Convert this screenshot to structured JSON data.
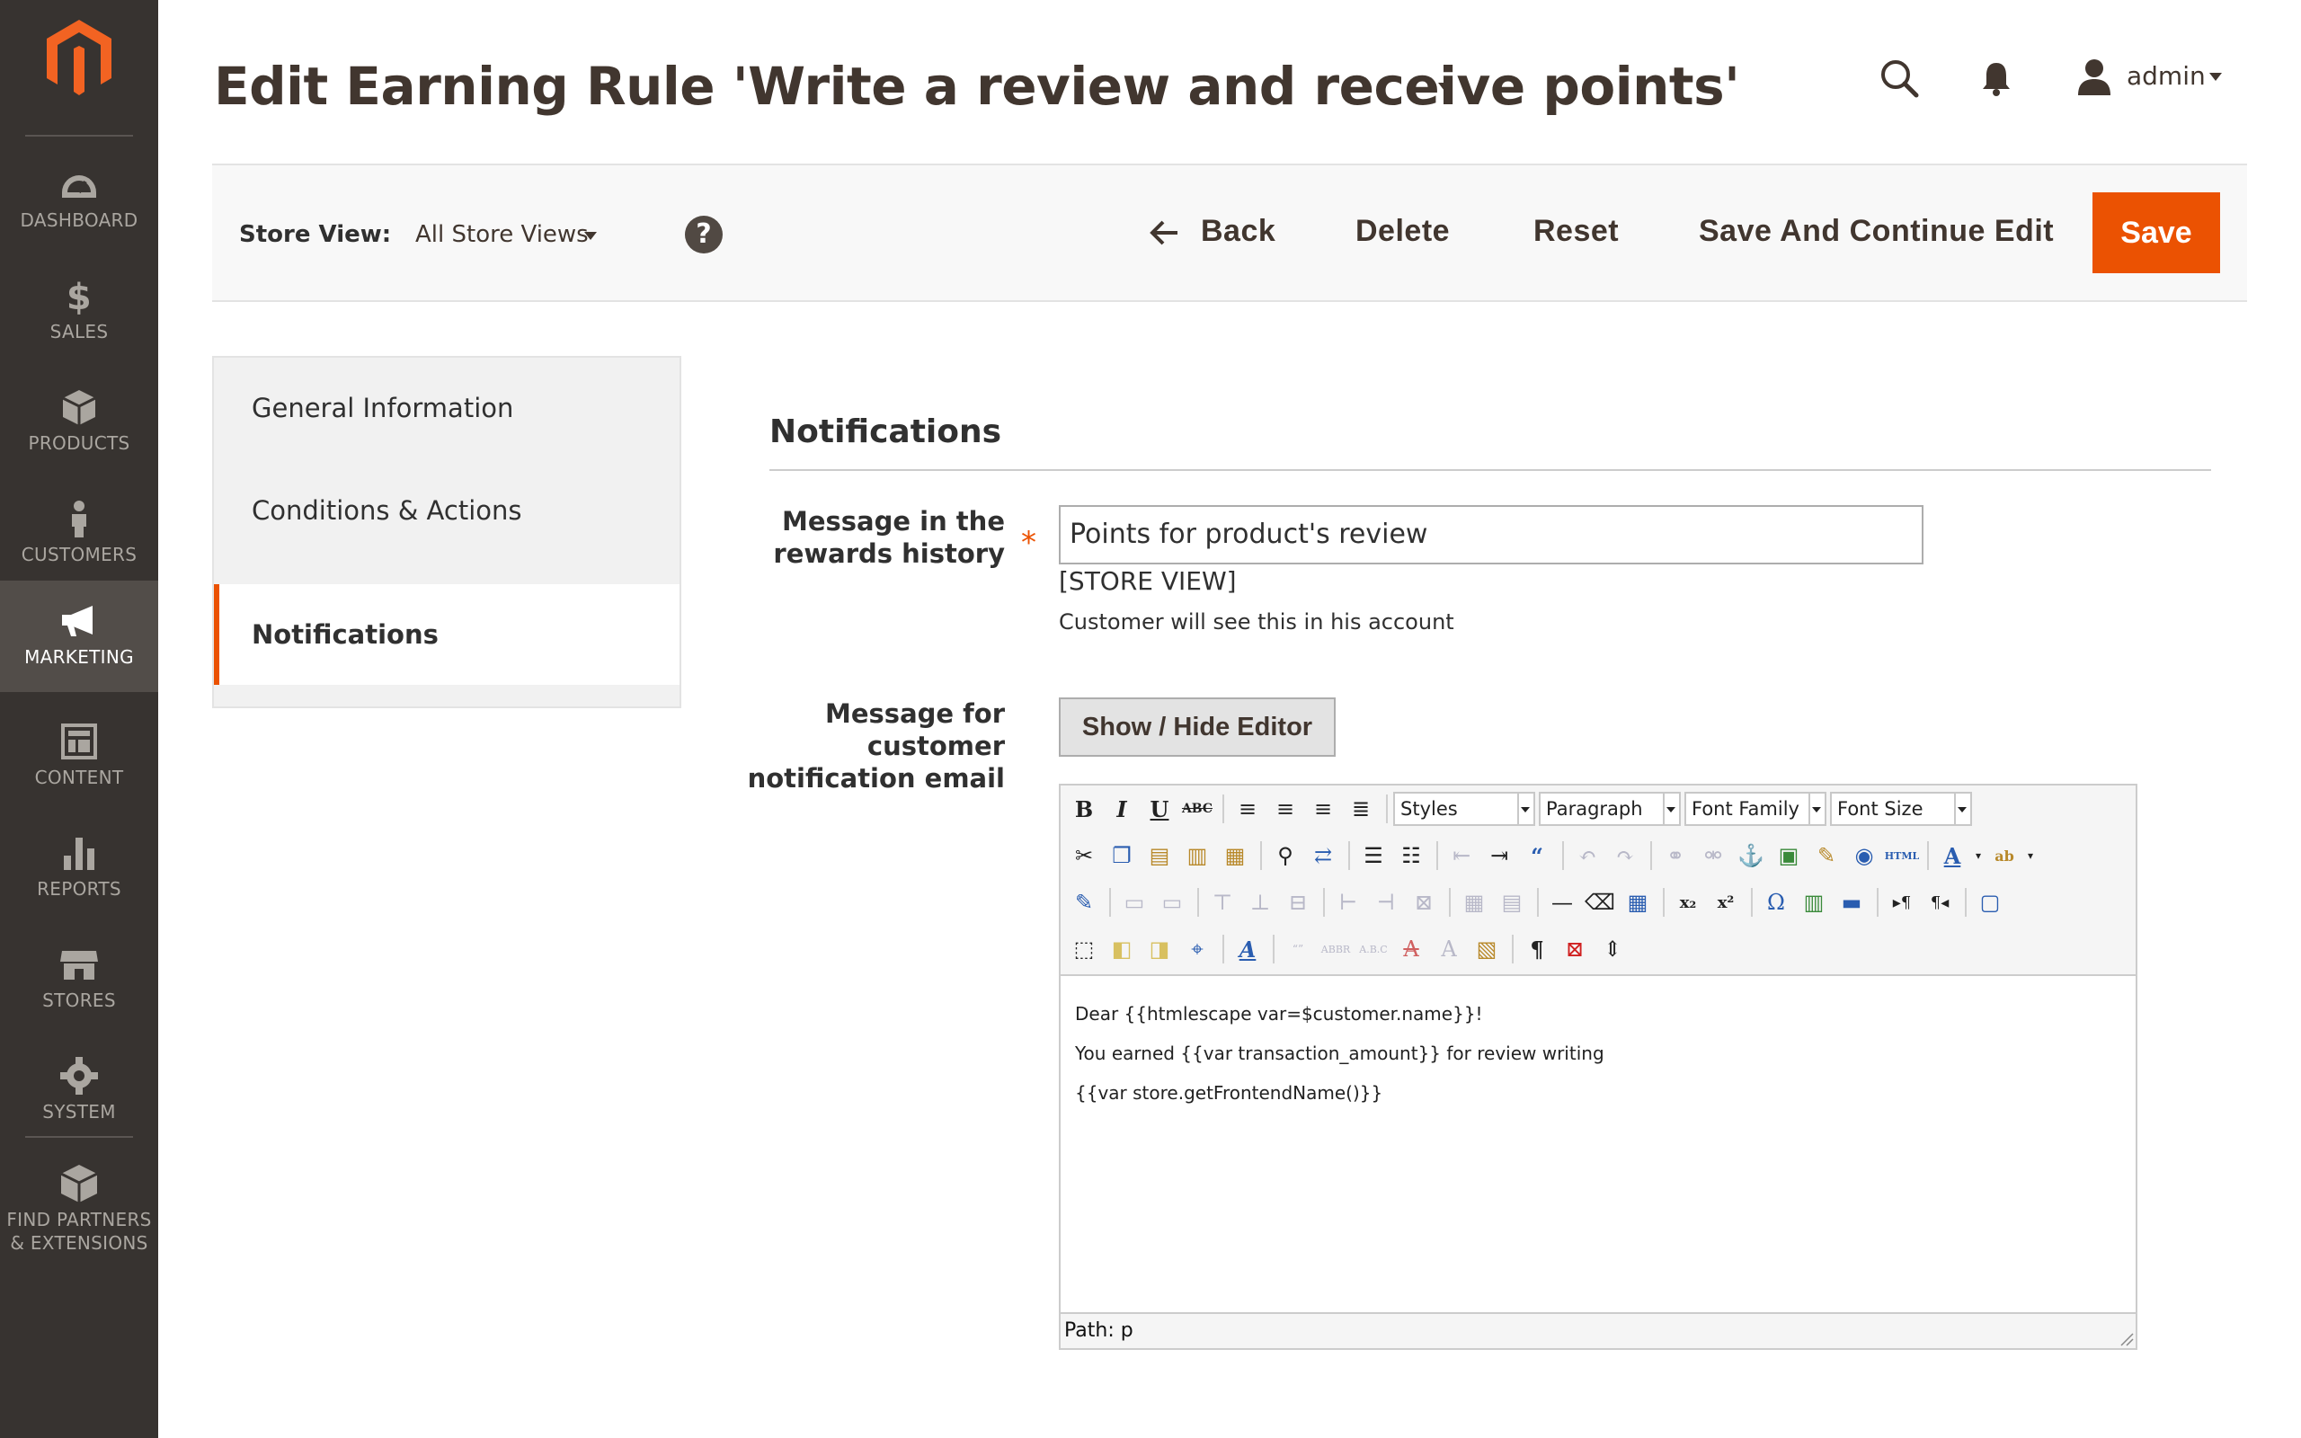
{
  "sidebar": {
    "items": [
      {
        "label": "DASHBOARD",
        "icon": "dashboard-icon"
      },
      {
        "label": "SALES",
        "icon": "dollar-icon"
      },
      {
        "label": "PRODUCTS",
        "icon": "box-icon"
      },
      {
        "label": "CUSTOMERS",
        "icon": "person-icon"
      },
      {
        "label": "MARKETING",
        "icon": "megaphone-icon",
        "active": true
      },
      {
        "label": "CONTENT",
        "icon": "layout-icon"
      },
      {
        "label": "REPORTS",
        "icon": "bar-chart-icon"
      },
      {
        "label": "STORES",
        "icon": "store-icon"
      },
      {
        "label": "SYSTEM",
        "icon": "gear-icon"
      },
      {
        "label": "FIND PARTNERS & EXTENSIONS",
        "line1": "FIND PARTNERS",
        "line2": "& EXTENSIONS",
        "icon": "boxes-icon"
      }
    ]
  },
  "header": {
    "title": "Edit Earning Rule 'Write a review and receive points'",
    "user": "admin"
  },
  "actionbar": {
    "store_view_label": "Store View:",
    "store_view_value": "All Store Views",
    "help": "?",
    "back": "Back",
    "delete": "Delete",
    "reset": "Reset",
    "save_continue": "Save And Continue Edit",
    "save": "Save"
  },
  "tabs": [
    {
      "label": "General Information"
    },
    {
      "label": "Conditions & Actions"
    },
    {
      "label": "Notifications",
      "active": true
    }
  ],
  "notifications": {
    "section_title": "Notifications",
    "history_label_1": "Message in the",
    "history_label_2": "rewards history",
    "history_value": "Points for product's review",
    "history_scope": "[STORE VIEW]",
    "history_note": "Customer will see this in his account",
    "email_label_1": "Message for",
    "email_label_2": "customer",
    "email_label_3": "notification email",
    "toggle_editor": "Show / Hide Editor"
  },
  "editor": {
    "styles": "Styles",
    "paragraph": "Paragraph",
    "font_family": "Font Family",
    "font_size": "Font Size",
    "lines": [
      "Dear {{htmlescape var=$customer.name}}!",
      "You earned {{var transaction_amount}} for review writing",
      "{{var store.getFrontendName()}}"
    ],
    "path": "Path: p"
  },
  "colors": {
    "sidebar_bg": "#373330",
    "accent": "#eb5202",
    "text_dark": "#41362f"
  }
}
